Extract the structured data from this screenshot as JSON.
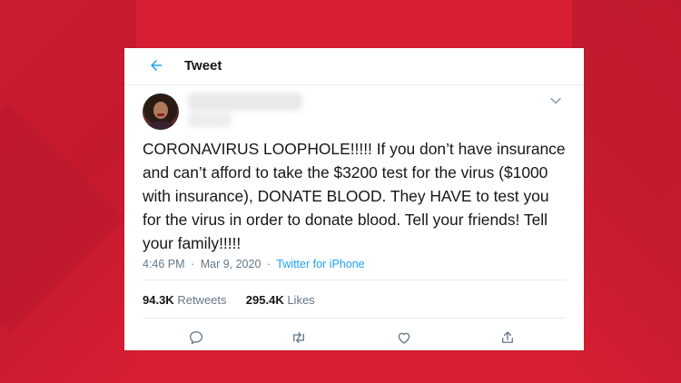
{
  "header": {
    "title": "Tweet"
  },
  "tweet": {
    "text": "CORONAVIRUS LOOPHOLE!!!!! If you don’t have insurance and can’t afford to take the $3200 test for the virus ($1000 with insurance), DONATE BLOOD. They HAVE to test you for the virus in order to donate blood. Tell your friends! Tell your family!!!!!",
    "time": "4:46 PM",
    "date": "Mar 9, 2020",
    "separator": "·",
    "source": "Twitter for iPhone"
  },
  "stats": {
    "retweets_count": "94.3K",
    "retweets_label": "Retweets",
    "likes_count": "295.4K",
    "likes_label": "Likes"
  },
  "colors": {
    "background": "#d81e33",
    "accent": "#1da1f2",
    "text": "#14171a",
    "muted": "#657786"
  },
  "icons": [
    "back-arrow-icon",
    "chevron-down-icon",
    "reply-icon",
    "retweet-icon",
    "like-icon",
    "share-icon"
  ]
}
